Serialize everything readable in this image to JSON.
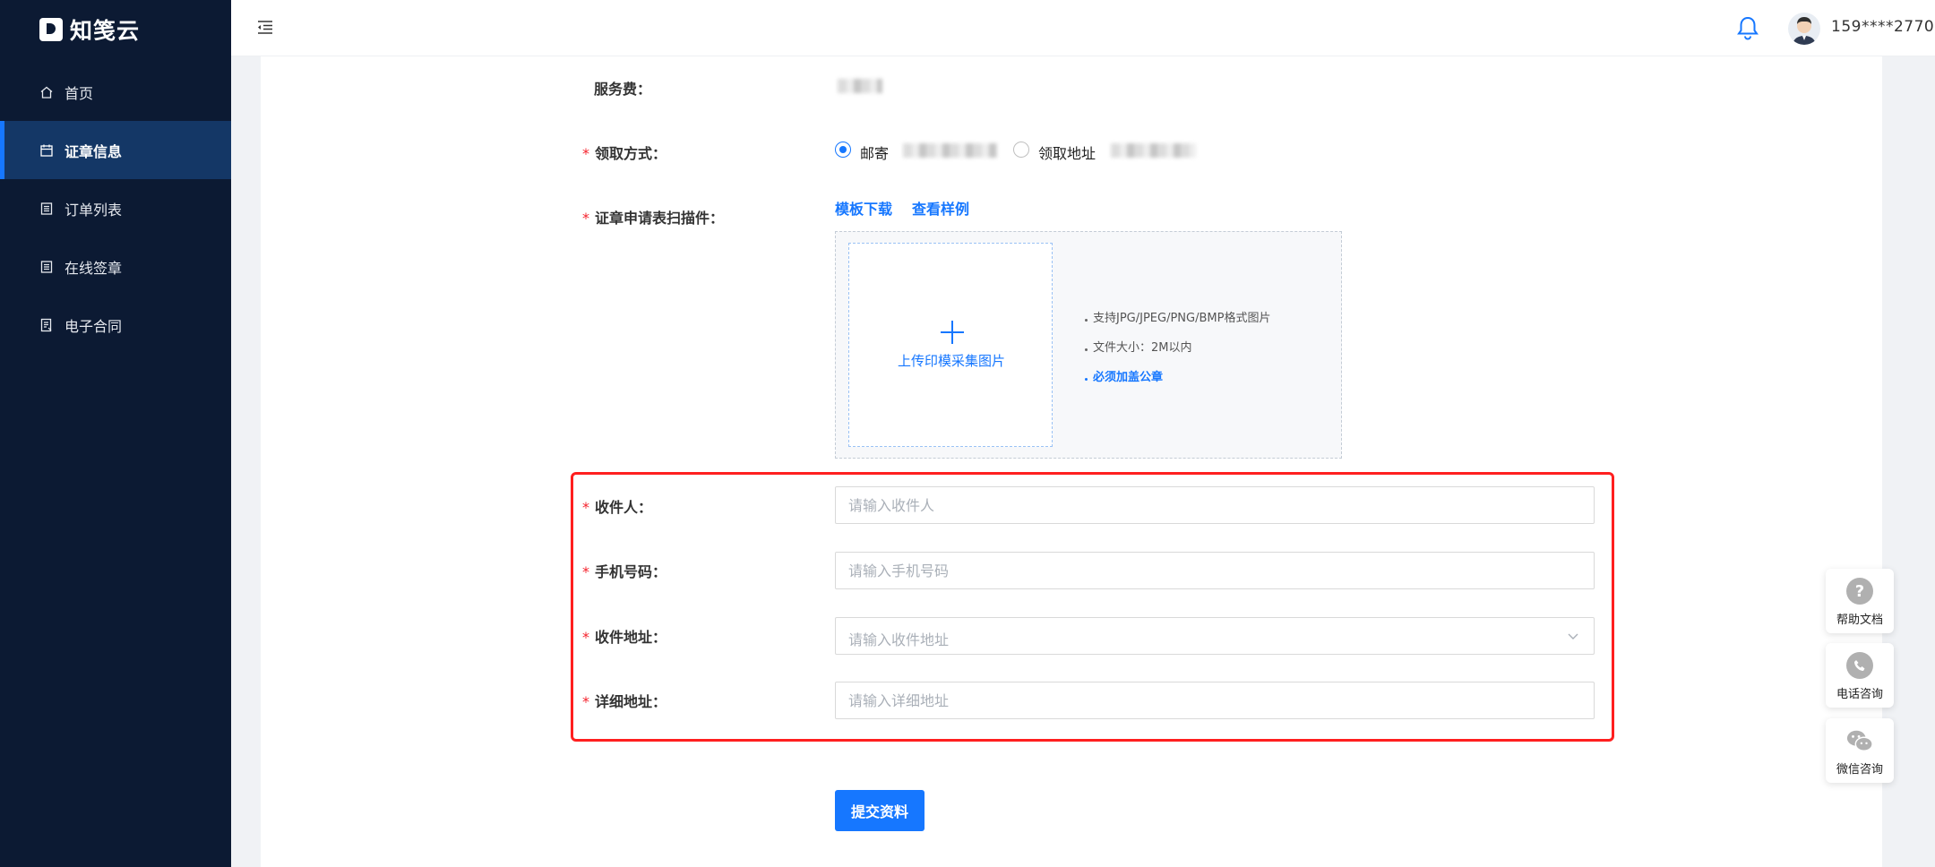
{
  "app": {
    "name": "知笺云"
  },
  "sidebar": {
    "items": [
      {
        "label": "首页",
        "icon": "home-icon",
        "active": false
      },
      {
        "label": "证章信息",
        "icon": "calendar-icon",
        "active": true
      },
      {
        "label": "订单列表",
        "icon": "list-icon",
        "active": false
      },
      {
        "label": "在线签章",
        "icon": "list-icon",
        "active": false
      },
      {
        "label": "电子合同",
        "icon": "contract-icon",
        "active": false
      }
    ]
  },
  "header": {
    "username": "159****2770"
  },
  "form": {
    "service_fee_label": "服务费：",
    "pickup_label": "领取方式：",
    "pickup_options": [
      {
        "label": "邮寄",
        "checked": true
      },
      {
        "label": "领取地址",
        "checked": false
      }
    ],
    "scan_label": "证章申请表扫描件：",
    "template_link": "模板下载",
    "sample_link": "查看样例",
    "upload_text": "上传印模采集图片",
    "tips": [
      "支持JPG/JPEG/PNG/BMP格式图片",
      "文件大小：2M以内",
      "必须加盖公章"
    ],
    "recipient_label": "收件人：",
    "recipient_placeholder": "请输入收件人",
    "phone_label": "手机号码：",
    "phone_placeholder": "请输入手机号码",
    "address_label": "收件地址：",
    "address_placeholder": "请输入收件地址",
    "detail_label": "详细地址：",
    "detail_placeholder": "请输入详细地址",
    "submit_label": "提交资料",
    "required_mark": "*"
  },
  "floating": [
    {
      "label": "帮助文档",
      "icon": "question-icon"
    },
    {
      "label": "电话咨询",
      "icon": "phone-icon"
    },
    {
      "label": "微信咨询",
      "icon": "wechat-icon"
    }
  ],
  "colors": {
    "sidebar_bg": "#0c1a33",
    "active_bg": "#143766",
    "accent": "#1677ff",
    "required": "#f5222d",
    "highlight_frame": "#ff1f1f"
  }
}
